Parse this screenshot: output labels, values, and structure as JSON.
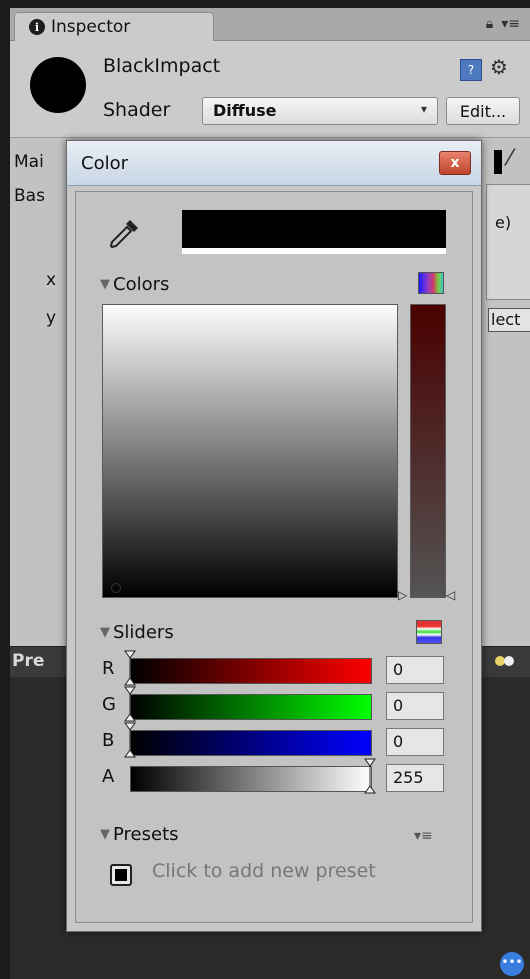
{
  "inspector": {
    "tab_label": "Inspector",
    "object_name": "BlackImpact",
    "shader_label": "Shader",
    "shader_value": "Diffuse",
    "edit_button": "Edit...",
    "behind": {
      "main_label": "Mai",
      "base_label": "Bas",
      "x_label": "x",
      "y_label": "y",
      "paren_text": "e)",
      "select_text": "lect"
    },
    "preview_label": "Pre"
  },
  "color_dialog": {
    "title": "Color",
    "close_label": "x",
    "current_color": "#000000",
    "colors_section": "Colors",
    "sliders_section": "Sliders",
    "presets_section": "Presets",
    "add_preset": "Click to add new preset",
    "sliders": [
      {
        "channel": "R",
        "value": "0"
      },
      {
        "channel": "G",
        "value": "0"
      },
      {
        "channel": "B",
        "value": "0"
      },
      {
        "channel": "A",
        "value": "255"
      }
    ],
    "colors": {
      "r_track_end": "#ff0000",
      "g_track_end": "#00ff00",
      "b_track_end": "#0000ff"
    }
  }
}
